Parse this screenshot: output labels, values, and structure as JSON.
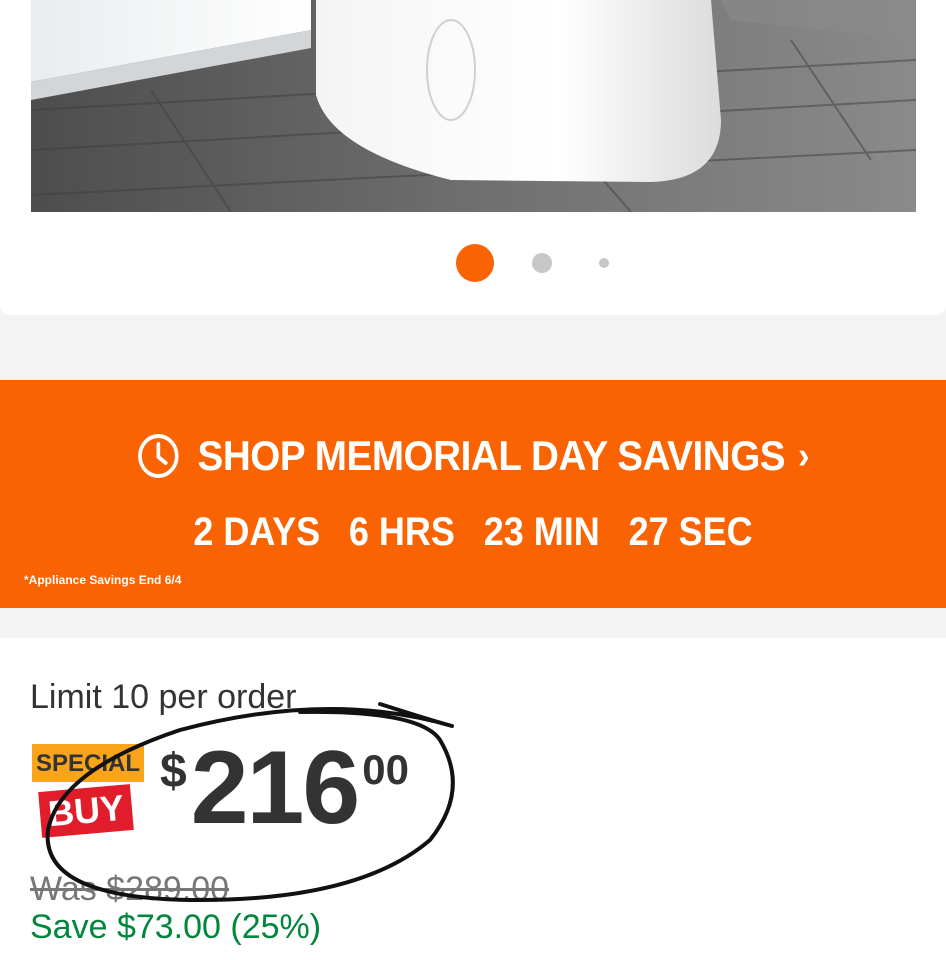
{
  "gallery": {
    "image_alt": "White toilet on wood floor",
    "dots": [
      {
        "state": "active",
        "color": "#f96302"
      },
      {
        "state": "inactive",
        "color": "#c7c7c7"
      },
      {
        "state": "inactive",
        "color": "#c7c7c7"
      }
    ]
  },
  "promo": {
    "icon": "clock-icon",
    "headline": "SHOP MEMORIAL DAY SAVINGS",
    "chevron": "›",
    "countdown": [
      "2 DAYS",
      "6 HRS",
      "23 MIN",
      "27 SEC"
    ],
    "note": "*Appliance Savings End 6/4",
    "bg_color": "#f96302"
  },
  "pricing": {
    "limit_text": "Limit 10 per order",
    "badge_top": "SPECIAL",
    "badge_bottom": "BUY",
    "currency": "$",
    "dollars": "216",
    "cents": "00",
    "was_text": "Was $289.00",
    "save_text": "Save $73.00 (25%)",
    "save_color": "#00873c"
  }
}
